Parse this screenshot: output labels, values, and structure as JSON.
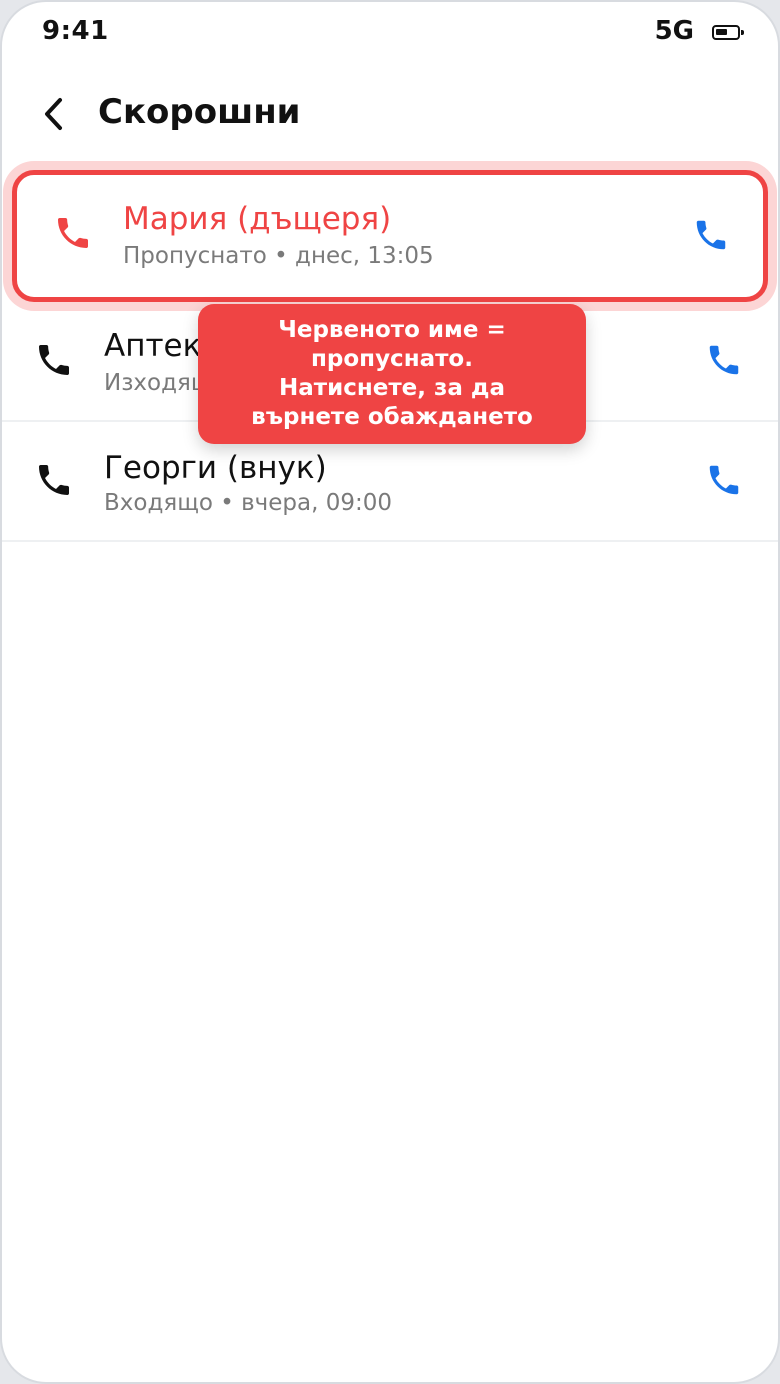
{
  "status_bar": {
    "time": "9:41",
    "network": "5G",
    "battery_level": 0.6
  },
  "header": {
    "title": "Скорошни",
    "back_icon": "chevron-left-icon"
  },
  "calls": [
    {
      "name": "Мария (дъщеря)",
      "detail": "Пропуснато • днес, 13:05",
      "type": "missed",
      "highlighted": true
    },
    {
      "name": "Аптека",
      "detail": "Изходящо • днес, 10:20",
      "type": "outgoing",
      "highlighted": false
    },
    {
      "name": "Георги (внук)",
      "detail": "Входящо • вчера, 09:00",
      "type": "incoming",
      "highlighted": false
    }
  ],
  "tooltip": {
    "lines": [
      "Червеното име =",
      "пропуснато.",
      "Натиснете, за да",
      "върнете обаждането"
    ]
  },
  "colors": {
    "missed": "#ef4444",
    "accent": "#1a73e8",
    "text": "#111111",
    "secondary_text": "#7a7a7a",
    "highlight_glow": "#fcd5d5"
  }
}
